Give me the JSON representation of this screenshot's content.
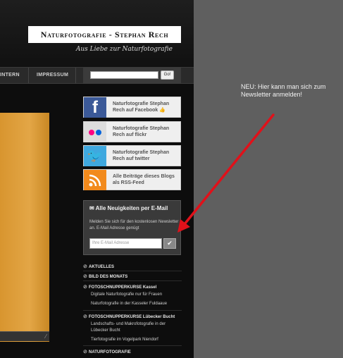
{
  "site": {
    "title": "Naturfotografie - Stephan Rech",
    "tagline": "Aus Liebe zur Naturfotografie"
  },
  "nav": {
    "items": [
      {
        "label": "INTERN"
      },
      {
        "label": "IMPRESSUM"
      }
    ],
    "search_value": "",
    "search_button": "Go!"
  },
  "social": [
    {
      "icon": "facebook-icon",
      "text": "Naturfotografie Stephan Rech auf Facebook 👍"
    },
    {
      "icon": "flickr-icon",
      "text": "Naturfotografie Stephan Rech auf flickr"
    },
    {
      "icon": "twitter-icon",
      "text": "Naturfotografie Stephan Rech auf twitter"
    },
    {
      "icon": "rss-icon",
      "text": "Alle Beiträge dieses Blogs als RSS-Feed"
    }
  ],
  "newsletter": {
    "title": "✉ Alle Neuigkeiten per E-Mail",
    "text": "Melden Sie sich für den kostenlosen Newsletter an. E-Mail Adresse genügt",
    "placeholder": "Ihre E-Mail Adresse",
    "button": "✔"
  },
  "links": [
    {
      "label": "AKTUELLES",
      "kind": "main"
    },
    {
      "label": "BILD DES MONATS",
      "kind": "main"
    },
    {
      "label": "FOTOSCHNUPPERKURSE Kassel",
      "kind": "main"
    },
    {
      "label": "Digitale Naturfotografie nur für Frauen",
      "kind": "sub"
    },
    {
      "label": "Naturfotografie in der Kasseler Fuldaaue",
      "kind": "sub"
    },
    {
      "label": "FOTOSCHNUPPERKURSE Lübecker Bucht",
      "kind": "main"
    },
    {
      "label": "Landschafts- und Makrofotografie in der",
      "kind": "sub"
    },
    {
      "label": "Lübecker Bucht",
      "kind": "sub"
    },
    {
      "label": "Tierfotografie im Vogelpark Niendorf",
      "kind": "sub"
    },
    {
      "label": "NATURFOTOGRAFIE",
      "kind": "main"
    }
  ],
  "annotation": {
    "text": "NEU: Hier kann man sich zum Newsletter anmelden!",
    "color": "#e0111a"
  }
}
